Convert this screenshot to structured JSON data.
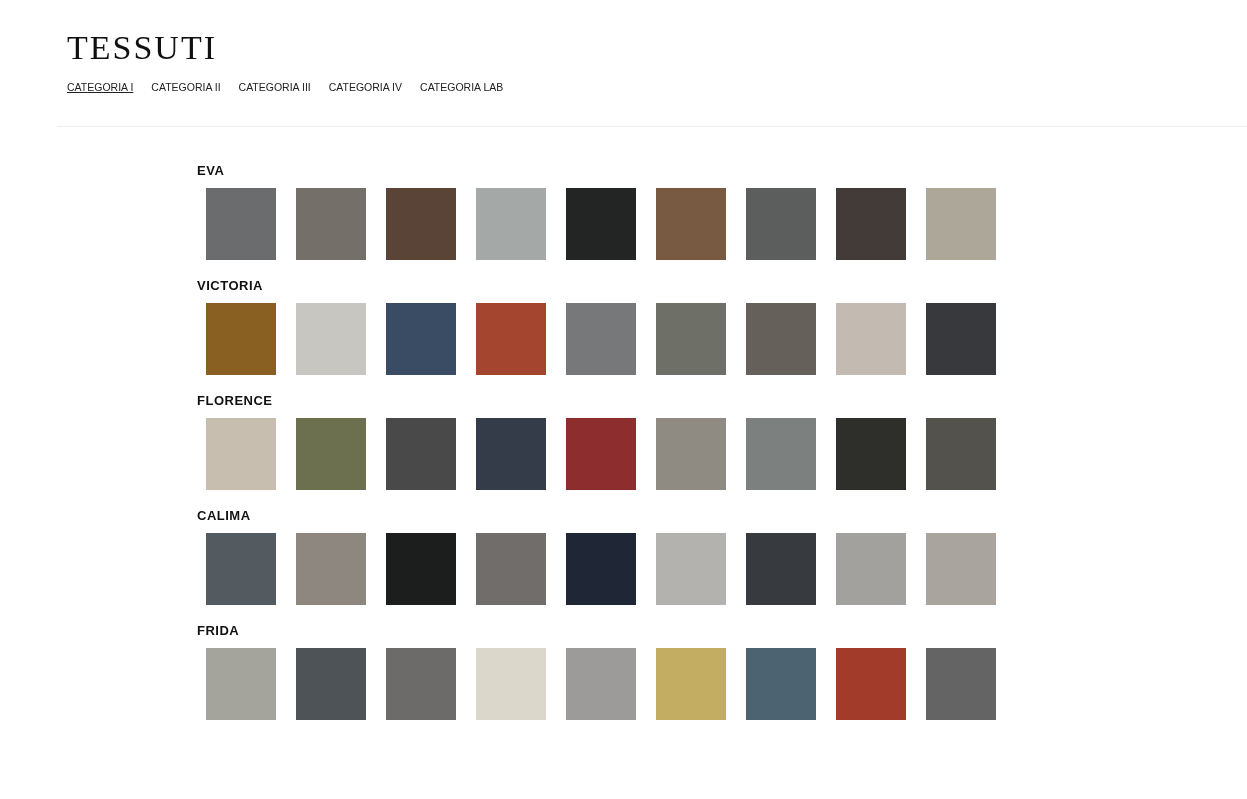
{
  "title": "TESSUTI",
  "tabs": [
    {
      "label": "CATEGORIA I",
      "selected": true
    },
    {
      "label": "CATEGORIA II",
      "selected": false
    },
    {
      "label": "CATEGORIA III",
      "selected": false
    },
    {
      "label": "CATEGORIA IV",
      "selected": false
    },
    {
      "label": "CATEGORIA LAB",
      "selected": false
    }
  ],
  "fabrics": [
    {
      "name": "EVA",
      "swatches": [
        {
          "color": "#6b6c6e"
        },
        {
          "color": "#747069"
        },
        {
          "color": "#5a4438"
        },
        {
          "color": "#a4a8a7"
        },
        {
          "color": "#232424"
        },
        {
          "color": "#775a41"
        },
        {
          "color": "#5c5d5d"
        },
        {
          "color": "#433b37"
        },
        {
          "color": "#aca798"
        }
      ]
    },
    {
      "name": "VICTORIA",
      "swatches": [
        {
          "color": "#8a6022"
        },
        {
          "color": "#c8c6c1"
        },
        {
          "color": "#3a4c63"
        },
        {
          "color": "#a3452f"
        },
        {
          "color": "#77787a"
        },
        {
          "color": "#6e6f66"
        },
        {
          "color": "#65605a"
        },
        {
          "color": "#c3bbb1"
        },
        {
          "color": "#38393d"
        }
      ]
    },
    {
      "name": "FLORENCE",
      "swatches": [
        {
          "color": "#c7beb0"
        },
        {
          "color": "#6c704f"
        },
        {
          "color": "#4a4949"
        },
        {
          "color": "#343b49"
        },
        {
          "color": "#8d2d2e"
        },
        {
          "color": "#8f8a82"
        },
        {
          "color": "#7c817f"
        },
        {
          "color": "#2e2f2b"
        },
        {
          "color": "#54524c"
        }
      ]
    },
    {
      "name": "CALIMA",
      "swatches": [
        {
          "color": "#535a60"
        },
        {
          "color": "#8d8780"
        },
        {
          "color": "#1c1d1d"
        },
        {
          "color": "#716d6a"
        },
        {
          "color": "#1f2636"
        },
        {
          "color": "#b3b2ae"
        },
        {
          "color": "#373a3f"
        },
        {
          "color": "#a2a19d"
        },
        {
          "color": "#a9a59e"
        }
      ]
    },
    {
      "name": "FRIDA",
      "swatches": [
        {
          "color": "#a4a39c"
        },
        {
          "color": "#4e5357"
        },
        {
          "color": "#6c6b69"
        },
        {
          "color": "#dcd7cb"
        },
        {
          "color": "#9c9b99"
        },
        {
          "color": "#c2ad63"
        },
        {
          "color": "#4c6472"
        },
        {
          "color": "#a23b2a"
        },
        {
          "color": "#636463"
        }
      ]
    }
  ]
}
